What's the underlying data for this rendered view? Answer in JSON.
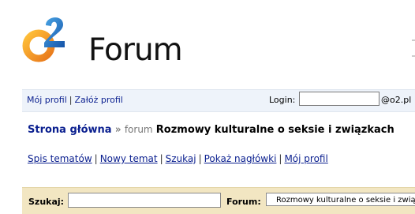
{
  "logo": {
    "brand": "o2",
    "text": "Forum"
  },
  "login_bar": {
    "my_profile": "Mój profil",
    "separator": "|",
    "create_profile": "Załóż profil",
    "login_label": "Login:",
    "login_value": "",
    "domain": "@o2.pl"
  },
  "breadcrumb": {
    "home": "Strona główna",
    "arrow": "»",
    "forum_word": "forum",
    "current": "Rozmowy kulturalne o seksie i związkach"
  },
  "nav": {
    "topics": "Spis tematów",
    "new_topic": "Nowy temat",
    "search": "Szukaj",
    "headers": "Pokaż nagłówki",
    "profile": "Mój profil",
    "separator": "|"
  },
  "search_bar": {
    "search_label": "Szukaj:",
    "search_value": "",
    "forum_label": "Forum:",
    "forum_selected": "Rozmowy kulturalne o seksie i związkach"
  },
  "colors": {
    "link": "#0a1f8f",
    "logo_orange": "#f49a2a",
    "logo_blue": "#1f73c4",
    "login_bar_bg": "#eef3fa",
    "search_bar_bg": "#f2e6c2"
  }
}
